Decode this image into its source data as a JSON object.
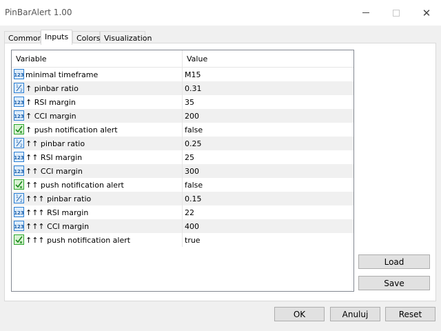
{
  "window": {
    "title": "PinBarAlert 1.00"
  },
  "tabs": [
    {
      "label": "Common"
    },
    {
      "label": "Inputs"
    },
    {
      "label": "Colors"
    },
    {
      "label": "Visualization"
    }
  ],
  "table": {
    "headers": {
      "variable": "Variable",
      "value": "Value"
    },
    "rows": [
      {
        "icon": "number-icon",
        "name": "minimal timeframe",
        "value": "M15"
      },
      {
        "icon": "fraction-icon",
        "name": "↑ pinbar ratio",
        "value": "0.31"
      },
      {
        "icon": "number-icon",
        "name": "↑ RSI margin",
        "value": "35"
      },
      {
        "icon": "number-icon",
        "name": "↑ CCI margin",
        "value": "200"
      },
      {
        "icon": "boolean-icon",
        "name": "↑ push notification alert",
        "value": "false"
      },
      {
        "icon": "fraction-icon",
        "name": "↑↑ pinbar ratio",
        "value": "0.25"
      },
      {
        "icon": "number-icon",
        "name": "↑↑ RSI margin",
        "value": "25"
      },
      {
        "icon": "number-icon",
        "name": "↑↑ CCI margin",
        "value": "300"
      },
      {
        "icon": "boolean-icon",
        "name": "↑↑ push notification alert",
        "value": "false"
      },
      {
        "icon": "fraction-icon",
        "name": "↑↑↑ pinbar ratio",
        "value": "0.15"
      },
      {
        "icon": "number-icon",
        "name": "↑↑↑ RSI margin",
        "value": "22"
      },
      {
        "icon": "number-icon",
        "name": "↑↑↑ CCI margin",
        "value": "400"
      },
      {
        "icon": "boolean-icon",
        "name": "↑↑↑ push notification alert",
        "value": "true"
      }
    ]
  },
  "buttons": {
    "load": "Load",
    "save": "Save",
    "ok": "OK",
    "cancel": "Anuluj",
    "reset": "Reset"
  },
  "colors": {
    "accent": "#0078d7",
    "row_alt": "#f0f0f0",
    "icon_number_blue": "#2a7fd4",
    "icon_bool_green": "#2aa52a"
  }
}
